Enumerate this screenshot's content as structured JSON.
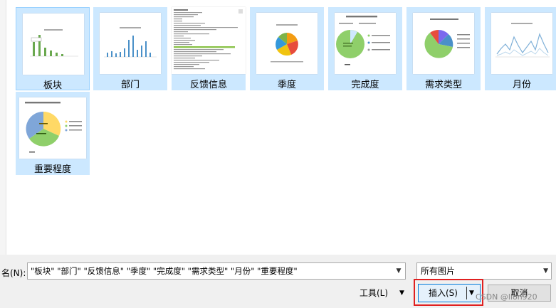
{
  "files": [
    {
      "label": "板块"
    },
    {
      "label": "部门"
    },
    {
      "label": "反馈信息"
    },
    {
      "label": "季度"
    },
    {
      "label": "完成度"
    },
    {
      "label": "需求类型"
    },
    {
      "label": "月份"
    },
    {
      "label": "重要程度"
    }
  ],
  "footer": {
    "filename_label": "名(N):",
    "filename_value": "\"板块\" \"部门\" \"反馈信息\" \"季度\" \"完成度\" \"需求类型\" \"月份\" \"重要程度\"",
    "filetype_value": "所有图片",
    "tools_label": "工具(L)",
    "insert_label": "插入(S)",
    "cancel_label": "取消"
  },
  "watermark": "CSDN @lion920",
  "icons": {
    "dropdown": "chevron-down-icon",
    "split": "split-arrow-icon"
  },
  "colors": {
    "selection": "#cce8ff",
    "highlight": "#e02020",
    "primary_border": "#0078d7"
  }
}
